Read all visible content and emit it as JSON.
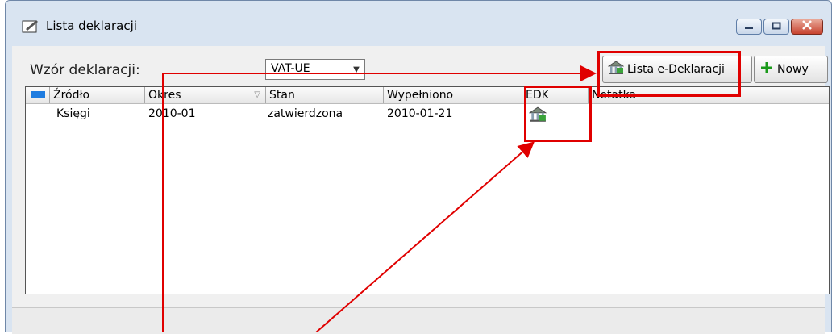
{
  "window": {
    "title": "Lista deklaracji"
  },
  "toolbar": {
    "wzor_label": "Wzór deklaracji:",
    "wzor_value": "VAT-UE",
    "edeklaracje_label": "Lista e-Deklaracji",
    "nowy_label": "Nowy"
  },
  "table": {
    "headers": [
      "Źródło",
      "Okres",
      "Stan",
      "Wypełniono",
      "EDK",
      "Notatka"
    ],
    "rows": [
      {
        "zrodlo": "Księgi",
        "okres": "2010-01",
        "stan": "zatwierdzona",
        "wypelniono": "2010-01-21",
        "edk_icon": "e-declaration-icon",
        "notatka": ""
      }
    ]
  },
  "colors": {
    "highlight": "#e00000",
    "accent": "#1e7ce0",
    "plus_icon": "#1a9a1a"
  },
  "icons": [
    "edit-icon",
    "minimize-icon",
    "maximize-icon",
    "close-icon",
    "e-declaration-icon",
    "plus-icon",
    "dropdown-arrow-icon",
    "sort-arrow-icon"
  ]
}
